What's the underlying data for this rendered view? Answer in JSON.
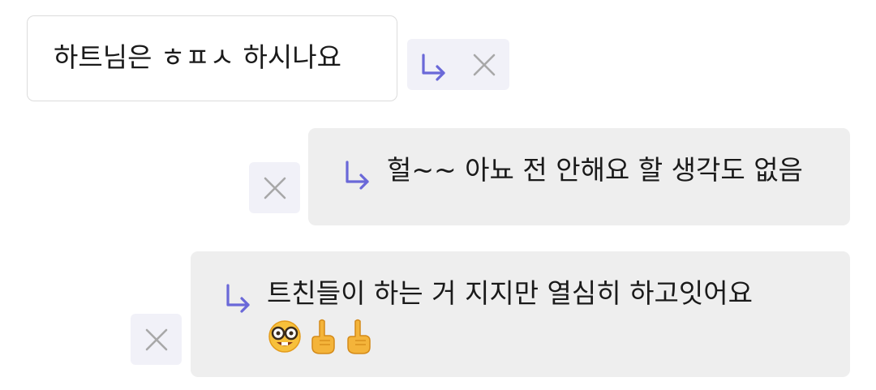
{
  "thread": {
    "root_comment": {
      "text": "하트님은 ㅎㅍㅅ 하시나요"
    },
    "replies": [
      {
        "text": "헐~~ 아뇨 전 안해요 할 생각도 없음"
      },
      {
        "text": "트친들이 하는 거 지지만 열심히 하고잇어요",
        "emojis": [
          "nerd-face-emoji",
          "pointing-up-emoji",
          "pointing-up-emoji"
        ]
      }
    ]
  },
  "colors": {
    "accent_arrow": "#6a68d8",
    "close_icon": "#a8a8a8",
    "action_bg": "#f1f1f8",
    "reply_bg": "#eeeeee"
  }
}
